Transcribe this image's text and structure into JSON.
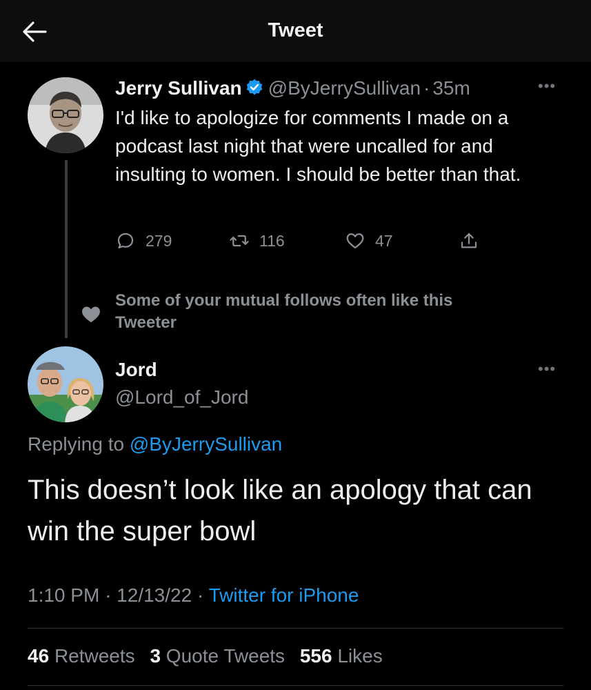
{
  "header": {
    "title": "Tweet"
  },
  "tweet1": {
    "name": "Jerry Sullivan",
    "handle": "@ByJerrySullivan",
    "separator": "·",
    "time": "35m",
    "text": "I'd like to apologize for comments I made on a podcast last night that were uncalled for and insulting to women. I should be better than that.",
    "replies": "279",
    "retweets": "116",
    "likes": "47"
  },
  "social_context": "Some of your mutual follows often like this Tweeter",
  "tweet2": {
    "name": "Jord",
    "handle": "@Lord_of_Jord",
    "replying_prefix": "Replying to",
    "replying_handle": "@ByJerrySullivan",
    "text": "This doesn’t look like an apology that can win the super bowl",
    "time": "1:10 PM",
    "separator": "·",
    "date": "12/13/22",
    "source": "Twitter for iPhone",
    "retweets_count": "46",
    "retweets_label": "Retweets",
    "quotes_count": "3",
    "quotes_label": "Quote Tweets",
    "likes_count": "556",
    "likes_label": "Likes"
  },
  "colors": {
    "accent": "#1d9bf0",
    "muted": "#8b9096",
    "background": "#000000"
  }
}
